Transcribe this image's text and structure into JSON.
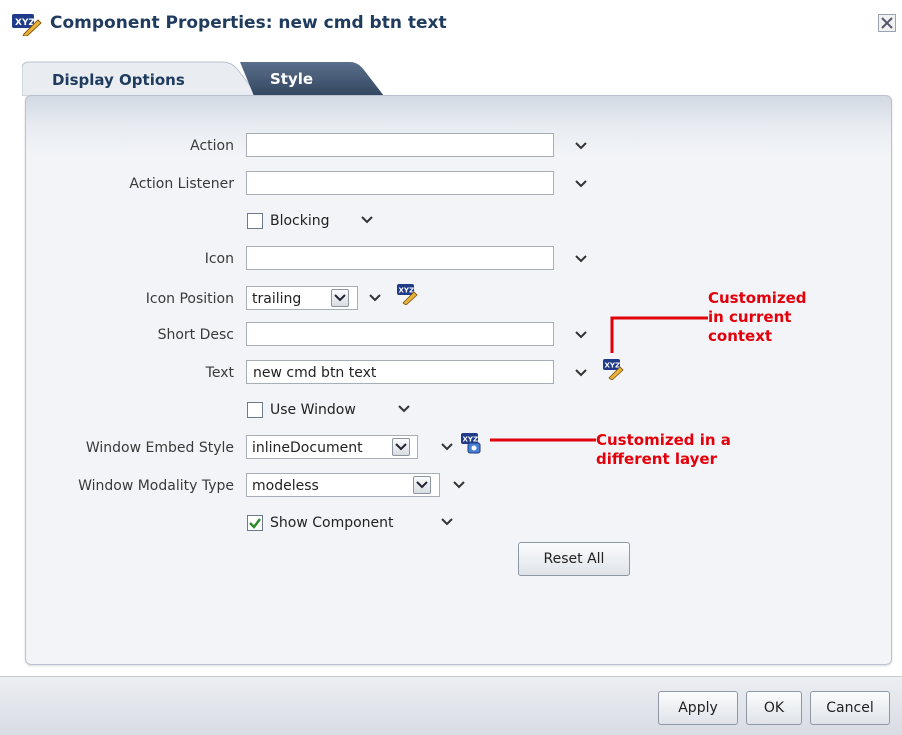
{
  "dialog": {
    "title": "Component Properties: new cmd btn text"
  },
  "tabs": [
    {
      "label": "Display Options",
      "active": true
    },
    {
      "label": "Style",
      "active": false
    }
  ],
  "form": {
    "action": {
      "label": "Action",
      "value": ""
    },
    "action_listener": {
      "label": "Action Listener",
      "value": ""
    },
    "blocking": {
      "label": "Blocking",
      "checked": false
    },
    "icon": {
      "label": "Icon",
      "value": ""
    },
    "icon_position": {
      "label": "Icon Position",
      "value": "trailing"
    },
    "short_desc": {
      "label": "Short Desc",
      "value": ""
    },
    "text": {
      "label": "Text",
      "value": "new cmd btn text"
    },
    "use_window": {
      "label": "Use Window",
      "checked": false
    },
    "window_embed_style": {
      "label": "Window Embed Style",
      "value": "inlineDocument"
    },
    "window_modality_type": {
      "label": "Window Modality Type",
      "value": "modeless"
    },
    "show_component": {
      "label": "Show Component",
      "checked": true
    },
    "reset_all_label": "Reset All"
  },
  "annotations": {
    "current_context": "Customized\nin current\ncontext",
    "different_layer": "Customized in a\ndifferent layer"
  },
  "buttons": {
    "apply": "Apply",
    "ok": "OK",
    "cancel": "Cancel"
  },
  "icons": {
    "title": "customize-xyz-icon",
    "close": "close-icon",
    "customized_current": "customized-current-context-icon",
    "customized_layer": "customized-different-layer-icon",
    "dropdown": "chevron-down-icon"
  },
  "colors": {
    "accent": "#1f3b5e",
    "annotation": "#e3000b",
    "check": "#2a8a2a"
  }
}
